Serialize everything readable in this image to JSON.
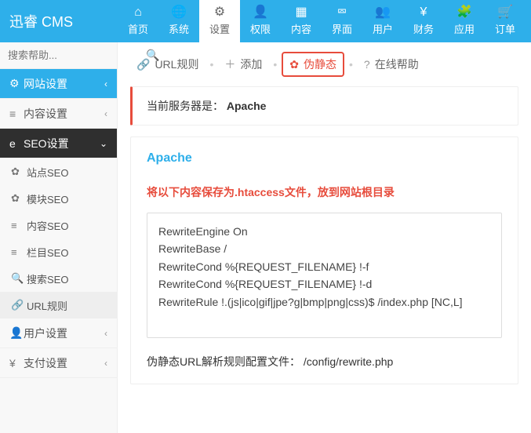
{
  "brand": "迅睿 CMS",
  "topMenu": [
    {
      "icon": "⌂",
      "label": "首页"
    },
    {
      "icon": "🌐",
      "label": "系统"
    },
    {
      "icon": "⚙",
      "label": "设置",
      "active": true
    },
    {
      "icon": "👤",
      "label": "权限"
    },
    {
      "icon": "▦",
      "label": "内容"
    },
    {
      "icon": "⮹",
      "label": "界面"
    },
    {
      "icon": "👥",
      "label": "用户"
    },
    {
      "icon": "¥",
      "label": "财务"
    },
    {
      "icon": "🧩",
      "label": "应用"
    },
    {
      "icon": "🛒",
      "label": "订单"
    }
  ],
  "search": {
    "placeholder": "搜索帮助..."
  },
  "sideGroups": [
    {
      "icon": "⚙",
      "label": "网站设置",
      "style": "primary",
      "arrow": "‹"
    },
    {
      "icon": "≡",
      "label": "内容设置",
      "style": "",
      "arrow": "‹"
    },
    {
      "icon": "e",
      "label": "SEO设置",
      "style": "dark",
      "arrow": "⌄",
      "open": true,
      "items": [
        {
          "icon": "✿",
          "label": "站点SEO"
        },
        {
          "icon": "✿",
          "label": "模块SEO"
        },
        {
          "icon": "≡",
          "label": "内容SEO"
        },
        {
          "icon": "≡",
          "label": "栏目SEO"
        },
        {
          "icon": "🔍",
          "label": "搜索SEO"
        },
        {
          "icon": "🔗",
          "label": "URL规则",
          "active": true
        }
      ]
    },
    {
      "icon": "👤",
      "label": "用户设置",
      "style": "",
      "arrow": "‹"
    },
    {
      "icon": "¥",
      "label": "支付设置",
      "style": "",
      "arrow": "‹"
    }
  ],
  "tabs": [
    {
      "icon": "🔗",
      "label": "URL规则"
    },
    {
      "icon": "＋",
      "label": "添加"
    },
    {
      "icon": "✿",
      "label": "伪静态",
      "active": true
    },
    {
      "icon": "?",
      "label": "在线帮助"
    }
  ],
  "notice": {
    "prefix": "当前服务器是：",
    "value": "Apache"
  },
  "panel": {
    "title": "Apache",
    "warn": "将以下内容保存为.htaccess文件，放到网站根目录",
    "code": "RewriteEngine On\nRewriteBase /\nRewriteCond %{REQUEST_FILENAME} !-f\nRewriteCond %{REQUEST_FILENAME} !-d\nRewriteRule !.(js|ico|gif|jpe?g|bmp|png|css)$ /index.php [NC,L]",
    "configLabel": "伪静态URL解析规则配置文件：",
    "configPath": "/config/rewrite.php"
  }
}
